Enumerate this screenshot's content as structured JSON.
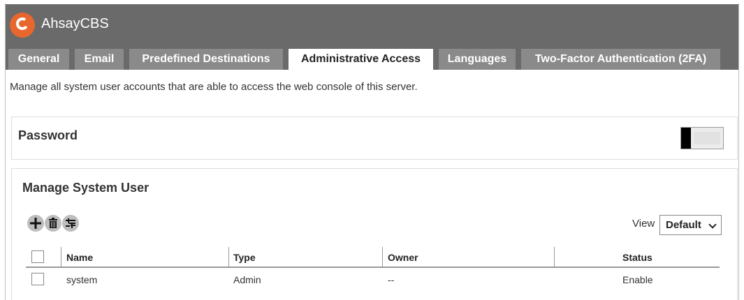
{
  "app": {
    "title": "AhsayCBS"
  },
  "tabs": [
    {
      "label": "General"
    },
    {
      "label": "Email"
    },
    {
      "label": "Predefined Destinations"
    },
    {
      "label": "Administrative Access"
    },
    {
      "label": "Languages"
    },
    {
      "label": "Two-Factor Authentication (2FA)"
    }
  ],
  "active_tab": "Administrative Access",
  "description": "Manage all system user accounts that are able to access the web console of this server.",
  "password": {
    "title": "Password",
    "toggle_state": "off"
  },
  "manage": {
    "title": "Manage System User",
    "toolbar_icons": [
      "add-icon",
      "delete-icon",
      "filter-icon"
    ],
    "view_label": "View",
    "view_selected": "Default",
    "table": {
      "headers": {
        "name": "Name",
        "type": "Type",
        "owner": "Owner",
        "status": "Status"
      },
      "rows": [
        {
          "name": "system",
          "type": "Admin",
          "owner": "--",
          "status": "Enable"
        }
      ]
    }
  },
  "colors": {
    "header_bg": "#6a6a6a",
    "tab_bg": "#8a8a8a",
    "logo": "#e8672e"
  }
}
